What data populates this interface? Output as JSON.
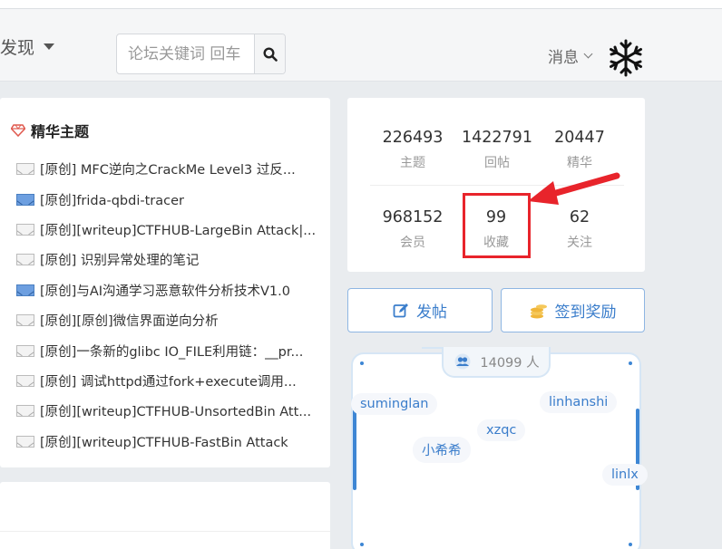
{
  "nav": {
    "discover_label": "发现",
    "search_placeholder": "论坛关键词 回车",
    "messages_label": "消息"
  },
  "highlights": {
    "title": "精华主题",
    "topics": [
      {
        "text": "[原创] MFC逆向之CrackMe Level3 过反...",
        "unread": false
      },
      {
        "text": "[原创]frida-qbdi-tracer",
        "unread": true
      },
      {
        "text": "[原创][writeup]CTFHUB-LargeBin Attack|...",
        "unread": false
      },
      {
        "text": "[原创] 识别异常处理的笔记",
        "unread": false
      },
      {
        "text": "[原创]与AI沟通学习恶意软件分析技术V1.0",
        "unread": true
      },
      {
        "text": "[原创][原创]微信界面逆向分析",
        "unread": false
      },
      {
        "text": "[原创]一条新的glibc IO_FILE利用链：__pr...",
        "unread": false
      },
      {
        "text": "[原创] 调试httpd通过fork+execute调用...",
        "unread": false
      },
      {
        "text": "[原创][writeup]CTFHUB-UnsortedBin Att...",
        "unread": false
      },
      {
        "text": "[原创][writeup]CTFHUB-FastBin Attack",
        "unread": false
      }
    ]
  },
  "stats": {
    "topics": {
      "value": "226493",
      "label": "主题"
    },
    "replies": {
      "value": "1422791",
      "label": "回帖"
    },
    "featured": {
      "value": "20447",
      "label": "精华"
    },
    "members": {
      "value": "968152",
      "label": "会员"
    },
    "favorites": {
      "value": "99",
      "label": "收藏"
    },
    "following": {
      "value": "62",
      "label": "关注"
    }
  },
  "actions": {
    "post_label": "发帖",
    "checkin_label": "签到奖励"
  },
  "online": {
    "count": "14099 人",
    "users": [
      "suminglan",
      "linhanshi",
      "xzqc",
      "小希希",
      "linlx"
    ]
  },
  "colors": {
    "accent": "#3a7dcb",
    "highlight_red": "#e8242b",
    "page_bg": "#e9ecef"
  }
}
